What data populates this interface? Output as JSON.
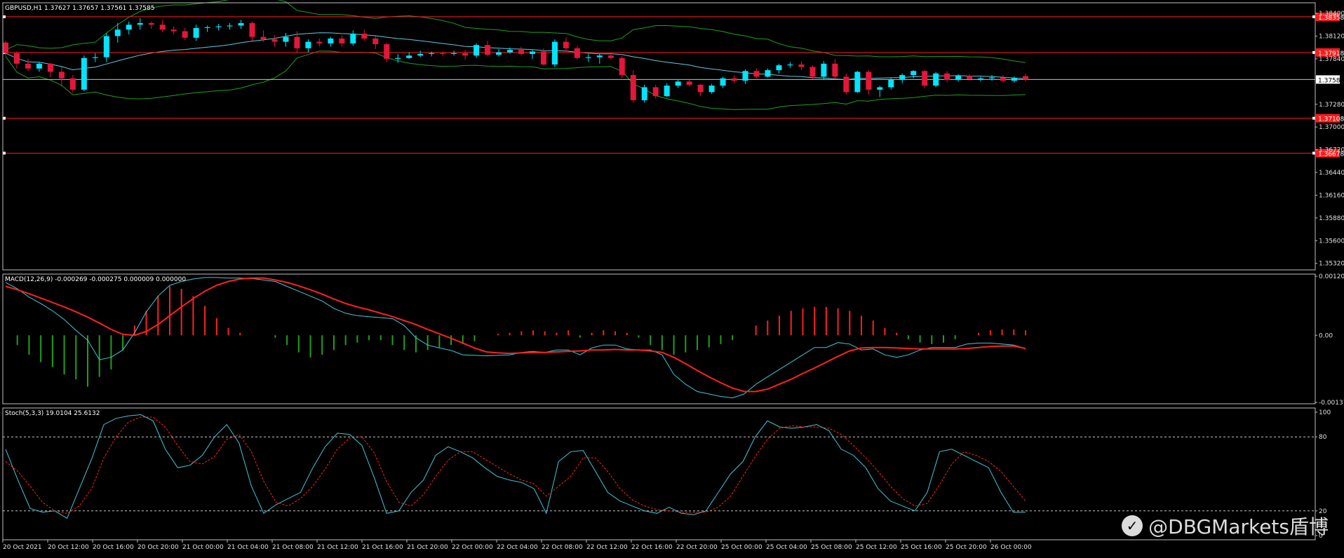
{
  "colors": {
    "bull": "#00e5ff",
    "bear": "#e4163a",
    "bollinger": "#1f9e1f",
    "ma": "#5ec8e0",
    "hline": "#ff1a1a",
    "frame": "#c0c0c0",
    "macd_main": "#40c8d8",
    "macd_signal": "#ff2020",
    "hist_pos": "#ff2020",
    "hist_neg": "#1fa01f",
    "stoch_k": "#40c8d8",
    "stoch_d": "#ff2020",
    "axis_text": "#e0e0e0"
  },
  "chart_data": [
    {
      "type": "candlestick",
      "title": "GBPUSD,H1  1.37627 1.37657 1.37561 1.37585",
      "ylim": [
        1.3524,
        1.3853
      ],
      "yticks": [
        "1.38400",
        "1.38120",
        "1.37840",
        "1.37585",
        "1.37280",
        "1.37000",
        "1.36720",
        "1.36440",
        "1.36160",
        "1.35880",
        "1.35600",
        "1.35320"
      ],
      "current_price_label": "1.37585",
      "levels": [
        {
          "value": 1.38358,
          "label": "1.38358"
        },
        {
          "value": 1.37918,
          "label": "1.37918"
        },
        {
          "value": 1.37108,
          "label": "1.37108"
        },
        {
          "value": 1.36678,
          "label": "1.36678"
        }
      ],
      "candles": [
        [
          1.3804,
          1.3806,
          1.3788,
          1.3791
        ],
        [
          1.3791,
          1.3793,
          1.3772,
          1.3778
        ],
        [
          1.3778,
          1.3784,
          1.3769,
          1.3772
        ],
        [
          1.3772,
          1.378,
          1.3768,
          1.3778
        ],
        [
          1.3778,
          1.3779,
          1.3761,
          1.3768
        ],
        [
          1.3768,
          1.3774,
          1.375,
          1.376
        ],
        [
          1.376,
          1.3764,
          1.3742,
          1.3746
        ],
        [
          1.3746,
          1.3788,
          1.3744,
          1.3785
        ],
        [
          1.3785,
          1.3791,
          1.378,
          1.3786
        ],
        [
          1.3786,
          1.3816,
          1.378,
          1.3812
        ],
        [
          1.3812,
          1.3828,
          1.3804,
          1.382
        ],
        [
          1.382,
          1.383,
          1.3814,
          1.3826
        ],
        [
          1.3826,
          1.3834,
          1.382,
          1.3828
        ],
        [
          1.3828,
          1.383,
          1.3821,
          1.3826
        ],
        [
          1.3826,
          1.3832,
          1.3817,
          1.382
        ],
        [
          1.382,
          1.3824,
          1.3814,
          1.3818
        ],
        [
          1.3818,
          1.3822,
          1.3807,
          1.381
        ],
        [
          1.381,
          1.3826,
          1.3806,
          1.3822
        ],
        [
          1.3822,
          1.3825,
          1.3817,
          1.3823
        ],
        [
          1.3823,
          1.3827,
          1.3819,
          1.3824
        ],
        [
          1.3824,
          1.3828,
          1.382,
          1.3825
        ],
        [
          1.3825,
          1.3832,
          1.3821,
          1.3828
        ],
        [
          1.3828,
          1.383,
          1.3806,
          1.3811
        ],
        [
          1.3811,
          1.3819,
          1.3805,
          1.3808
        ],
        [
          1.3808,
          1.3813,
          1.3799,
          1.3805
        ],
        [
          1.3805,
          1.3816,
          1.3799,
          1.3811
        ],
        [
          1.3811,
          1.3818,
          1.3792,
          1.3797
        ],
        [
          1.3797,
          1.3808,
          1.3792,
          1.3805
        ],
        [
          1.3805,
          1.3809,
          1.3799,
          1.3803
        ],
        [
          1.3803,
          1.3811,
          1.3799,
          1.3809
        ],
        [
          1.3809,
          1.3813,
          1.3799,
          1.3803
        ],
        [
          1.3803,
          1.3819,
          1.38,
          1.3815
        ],
        [
          1.3815,
          1.382,
          1.3806,
          1.3809
        ],
        [
          1.3809,
          1.3812,
          1.3796,
          1.3802
        ],
        [
          1.3802,
          1.3804,
          1.378,
          1.3784
        ],
        [
          1.3784,
          1.379,
          1.3779,
          1.3785
        ],
        [
          1.3785,
          1.3792,
          1.3784,
          1.3788
        ],
        [
          1.3788,
          1.3794,
          1.3786,
          1.379
        ],
        [
          1.379,
          1.3793,
          1.3787,
          1.3791
        ],
        [
          1.3791,
          1.3793,
          1.3787,
          1.379
        ],
        [
          1.379,
          1.3794,
          1.3788,
          1.3791
        ],
        [
          1.3791,
          1.3795,
          1.3783,
          1.3788
        ],
        [
          1.3788,
          1.3803,
          1.3785,
          1.3801
        ],
        [
          1.3801,
          1.3806,
          1.3788,
          1.3789
        ],
        [
          1.3789,
          1.3796,
          1.3787,
          1.3792
        ],
        [
          1.3792,
          1.3798,
          1.379,
          1.3795
        ],
        [
          1.3795,
          1.3799,
          1.3788,
          1.379
        ],
        [
          1.379,
          1.3795,
          1.3784,
          1.3793
        ],
        [
          1.3793,
          1.3797,
          1.3775,
          1.3777
        ],
        [
          1.3777,
          1.3808,
          1.3774,
          1.3805
        ],
        [
          1.3805,
          1.381,
          1.3793,
          1.3797
        ],
        [
          1.3797,
          1.38,
          1.3783,
          1.3785
        ],
        [
          1.3785,
          1.379,
          1.378,
          1.3786
        ],
        [
          1.3786,
          1.379,
          1.3778,
          1.3788
        ],
        [
          1.3788,
          1.3792,
          1.3783,
          1.3785
        ],
        [
          1.3785,
          1.3787,
          1.376,
          1.3764
        ],
        [
          1.3764,
          1.377,
          1.373,
          1.3733
        ],
        [
          1.3733,
          1.3752,
          1.373,
          1.3749
        ],
        [
          1.3749,
          1.3752,
          1.3735,
          1.3738
        ],
        [
          1.3738,
          1.3754,
          1.3737,
          1.3751
        ],
        [
          1.3751,
          1.3758,
          1.3748,
          1.3756
        ],
        [
          1.3756,
          1.3758,
          1.375,
          1.3752
        ],
        [
          1.3752,
          1.3753,
          1.3738,
          1.3743
        ],
        [
          1.3743,
          1.3753,
          1.3741,
          1.3751
        ],
        [
          1.3751,
          1.3762,
          1.3748,
          1.376
        ],
        [
          1.376,
          1.3764,
          1.3754,
          1.3757
        ],
        [
          1.3757,
          1.3771,
          1.3753,
          1.3769
        ],
        [
          1.3769,
          1.3772,
          1.376,
          1.3762
        ],
        [
          1.3762,
          1.3772,
          1.3761,
          1.377
        ],
        [
          1.377,
          1.3778,
          1.3766,
          1.3776
        ],
        [
          1.3776,
          1.378,
          1.3773,
          1.3777
        ],
        [
          1.3777,
          1.3781,
          1.377,
          1.3774
        ],
        [
          1.3774,
          1.3776,
          1.3759,
          1.3762
        ],
        [
          1.3762,
          1.3781,
          1.3759,
          1.3778
        ],
        [
          1.3778,
          1.3784,
          1.3759,
          1.3762
        ],
        [
          1.3762,
          1.3766,
          1.374,
          1.3743
        ],
        [
          1.3743,
          1.3769,
          1.3742,
          1.3768
        ],
        [
          1.3768,
          1.377,
          1.374,
          1.3746
        ],
        [
          1.3746,
          1.3751,
          1.3737,
          1.3749
        ],
        [
          1.3749,
          1.3761,
          1.3746,
          1.3758
        ],
        [
          1.3758,
          1.3766,
          1.3754,
          1.3764
        ],
        [
          1.3764,
          1.377,
          1.376,
          1.3769
        ],
        [
          1.3769,
          1.377,
          1.3748,
          1.3751
        ],
        [
          1.3751,
          1.3768,
          1.3749,
          1.3766
        ],
        [
          1.3766,
          1.3769,
          1.3755,
          1.3758
        ],
        [
          1.3758,
          1.3765,
          1.3756,
          1.3763
        ],
        [
          1.3763,
          1.3765,
          1.3757,
          1.3759
        ],
        [
          1.3759,
          1.3762,
          1.3756,
          1.376
        ],
        [
          1.376,
          1.3764,
          1.3757,
          1.3761
        ],
        [
          1.3761,
          1.3764,
          1.3755,
          1.3757
        ],
        [
          1.3757,
          1.3762,
          1.3755,
          1.376
        ],
        [
          1.37627,
          1.37657,
          1.37561,
          1.37585
        ]
      ]
    },
    {
      "type": "line",
      "title": "MACD(12,26,9) -0.000269 -0.000275 0.000009 0.000000",
      "ylim": [
        -0.0014,
        0.00125
      ],
      "yticks": [
        "0.001206",
        "0.00",
        "-0.001372"
      ],
      "series": [
        {
          "key": "main",
          "values": [
            0.00108,
            0.00095,
            0.00078,
            0.00065,
            0.0005,
            0.00032,
            0.0001,
            -0.0001,
            -0.0005,
            -0.00045,
            -0.0003,
            5e-05,
            0.00048,
            0.0008,
            0.00102,
            0.0011,
            0.00115,
            0.00118,
            0.00118,
            0.00117,
            0.00117,
            0.00116,
            0.00113,
            0.0011,
            0.001,
            0.0009,
            0.0008,
            0.0007,
            0.00055,
            0.00045,
            0.0004,
            0.00038,
            0.00036,
            0.00034,
            0.0002,
            -5e-05,
            -0.0002,
            -0.00026,
            -0.00031,
            -0.0004,
            -0.00041,
            -0.00042,
            -0.00041,
            -0.0004,
            -0.00035,
            -0.00033,
            -0.00035,
            -0.0003,
            -0.0003,
            -0.0004,
            -0.00026,
            -0.0002,
            -0.0002,
            -0.00028,
            -0.0003,
            -0.0003,
            -0.0004,
            -0.0008,
            -0.001,
            -0.00115,
            -0.0012,
            -0.00125,
            -0.00128,
            -0.0012,
            -0.001,
            -0.00085,
            -0.0007,
            -0.00055,
            -0.0004,
            -0.00025,
            -0.00025,
            -0.00015,
            -0.00018,
            -0.0003,
            -0.00028,
            -0.0004,
            -0.00045,
            -0.0004,
            -0.0003,
            -0.00025,
            -0.00025,
            -0.00025,
            -0.00018,
            -0.00016,
            -0.00016,
            -0.00018,
            -0.0002,
            -0.00027
          ]
        },
        {
          "key": "signal",
          "values": [
            0.001,
            0.00093,
            0.00085,
            0.00076,
            0.00067,
            0.00058,
            0.00048,
            0.00037,
            0.00025,
            0.00012,
            2e-05,
            0.0,
            8e-05,
            0.00022,
            0.0004,
            0.00058,
            0.00075,
            0.0009,
            0.00102,
            0.0011,
            0.00115,
            0.00117,
            0.00117,
            0.00113,
            0.00108,
            0.00101,
            0.00093,
            0.00084,
            0.00074,
            0.00065,
            0.00058,
            0.00052,
            0.00045,
            0.00038,
            0.0003,
            0.00022,
            0.00012,
            3e-05,
            -6e-05,
            -0.00016,
            -0.00026,
            -0.00034,
            -0.00036,
            -0.00037,
            -0.00036,
            -0.00035,
            -0.00035,
            -0.00034,
            -0.00033,
            -0.00032,
            -0.0003,
            -0.0003,
            -0.00029,
            -0.0003,
            -0.0003,
            -0.00032,
            -0.00035,
            -0.00045,
            -0.00058,
            -0.00072,
            -0.00085,
            -0.00097,
            -0.00108,
            -0.00115,
            -0.00115,
            -0.0011,
            -0.001,
            -0.0009,
            -0.00078,
            -0.00067,
            -0.00055,
            -0.00043,
            -0.00032,
            -0.00026,
            -0.00025,
            -0.00025,
            -0.00026,
            -0.00027,
            -0.00028,
            -0.00028,
            -0.00028,
            -0.00028,
            -0.00027,
            -0.00025,
            -0.00023,
            -0.00022,
            -0.00022,
            -0.00027
          ]
        }
      ],
      "histogram": [
        0,
        -0.0002,
        -0.0004,
        -0.00055,
        -0.00065,
        -0.0008,
        -0.0009,
        -0.00105,
        -0.00085,
        -0.0007,
        -0.0003,
        0.0002,
        0.0005,
        0.0008,
        0.001,
        0.00095,
        0.0008,
        0.0006,
        0.00035,
        0.00015,
        5e-05,
        0,
        0,
        -5e-05,
        -0.0002,
        -0.00035,
        -0.00045,
        -0.0004,
        -0.0003,
        -0.0002,
        -0.00015,
        -0.0001,
        -0.0001,
        -0.0002,
        -0.0003,
        -0.00035,
        -0.0003,
        -0.00025,
        -0.0002,
        -0.00018,
        -0.00012,
        0,
        3e-05,
        5e-05,
        8e-05,
        0.0001,
        8e-05,
        5e-05,
        0.0001,
        -5e-05,
        5e-05,
        0.0001,
        8e-05,
        5e-05,
        -5e-05,
        -0.0002,
        -0.0003,
        -0.0004,
        -0.00035,
        -0.0003,
        -0.00025,
        -0.00018,
        -0.0001,
        0,
        0.0002,
        0.0003,
        0.0004,
        0.0005,
        0.00055,
        0.00058,
        0.00058,
        0.00055,
        0.0005,
        0.0004,
        0.0003,
        0.00015,
        5e-05,
        -8e-05,
        -0.00015,
        -0.00018,
        -0.00015,
        -8e-05,
        0,
        5e-05,
        0.0001,
        0.00012,
        0.00012,
        0.0001
      ]
    },
    {
      "type": "line",
      "title": "Stoch(5,3,3) 19.0104 25.6132",
      "ylim": [
        0,
        100
      ],
      "yticks": [
        "100",
        "80",
        "20",
        "0"
      ],
      "levels": [
        80,
        20
      ],
      "series": [
        {
          "key": "k",
          "values": [
            70,
            45,
            22,
            19,
            20,
            14,
            38,
            62,
            90,
            95,
            97,
            98,
            93,
            70,
            55,
            57,
            65,
            80,
            90,
            75,
            40,
            18,
            25,
            30,
            35,
            55,
            72,
            83,
            82,
            73,
            47,
            18,
            20,
            35,
            45,
            65,
            72,
            68,
            63,
            55,
            48,
            45,
            43,
            38,
            18,
            60,
            68,
            69,
            52,
            35,
            28,
            24,
            20,
            18,
            23,
            18,
            17,
            20,
            35,
            50,
            60,
            80,
            93,
            88,
            87,
            88,
            90,
            85,
            70,
            65,
            55,
            38,
            28,
            24,
            20,
            35,
            68,
            70,
            65,
            60,
            55,
            35,
            19,
            19
          ]
        },
        {
          "key": "d",
          "values": [
            60,
            52,
            40,
            27,
            20,
            18,
            24,
            38,
            63,
            80,
            92,
            96,
            96,
            88,
            73,
            60,
            58,
            64,
            78,
            82,
            68,
            44,
            27,
            24,
            30,
            40,
            54,
            70,
            79,
            80,
            67,
            44,
            27,
            24,
            33,
            48,
            61,
            68,
            68,
            62,
            56,
            50,
            45,
            42,
            32,
            40,
            48,
            63,
            63,
            52,
            38,
            29,
            24,
            21,
            20,
            19,
            19,
            19,
            23,
            32,
            48,
            64,
            78,
            87,
            89,
            88,
            88,
            87,
            82,
            73,
            63,
            52,
            40,
            30,
            24,
            26,
            41,
            58,
            68,
            65,
            60,
            52,
            40,
            28
          ]
        }
      ]
    }
  ],
  "x_axis_labels": [
    "20 Oct 2021",
    "20 Oct 12:00",
    "20 Oct 16:00",
    "20 Oct 20:00",
    "21 Oct 00:00",
    "21 Oct 04:00",
    "21 Oct 08:00",
    "21 Oct 12:00",
    "21 Oct 16:00",
    "21 Oct 20:00",
    "22 Oct 00:00",
    "22 Oct 04:00",
    "22 Oct 08:00",
    "22 Oct 12:00",
    "22 Oct 16:00",
    "22 Oct 20:00",
    "25 Oct 00:00",
    "25 Oct 04:00",
    "25 Oct 08:00",
    "25 Oct 12:00",
    "25 Oct 16:00",
    "25 Oct 20:00",
    "26 Oct 00:00"
  ],
  "watermark": "@DBGMarkets盾博"
}
